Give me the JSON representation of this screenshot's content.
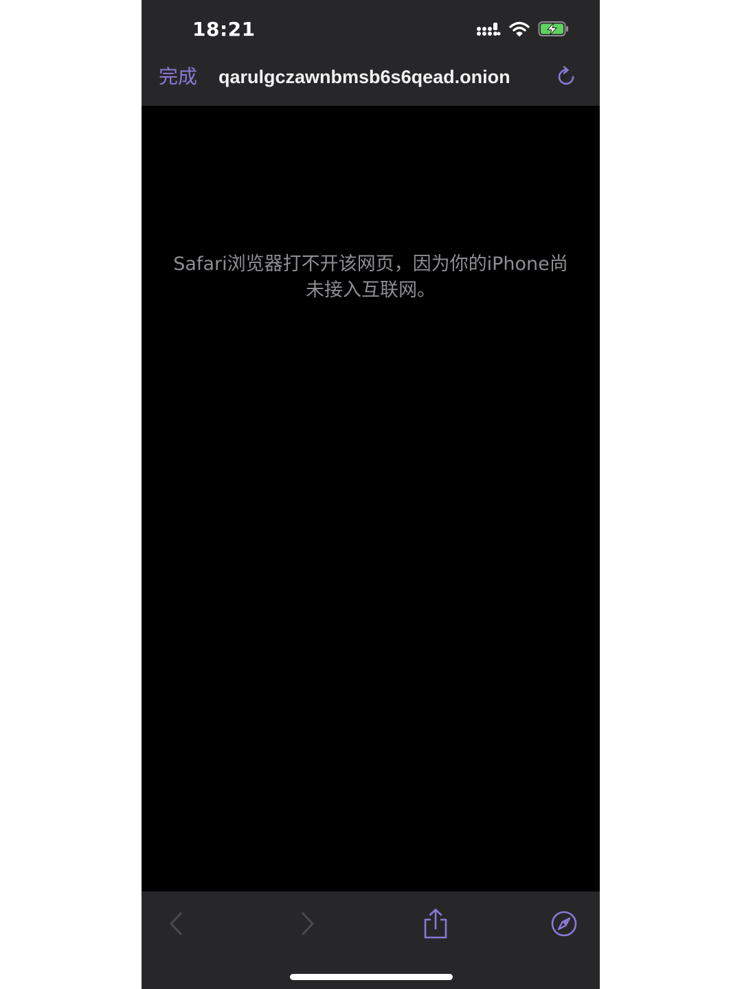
{
  "status_bar": {
    "time": "18:21",
    "icons": [
      "cellular-signal-icon",
      "wifi-icon",
      "battery-charging-icon"
    ]
  },
  "nav_bar": {
    "done_label": "完成",
    "url": "qarulgczawnbmsb6s6qead.onion",
    "reload_icon": "reload-icon"
  },
  "content": {
    "error_message": "Safari浏览器打不开该网页，因为你的iPhone尚未接入互联网。"
  },
  "toolbar": {
    "items": [
      "back-icon",
      "forward-icon",
      "share-icon",
      "compass-icon"
    ]
  },
  "colors": {
    "accent": "#8b78d6",
    "bar_background": "#272729",
    "page_background": "#000000",
    "message_text": "#8e8e93",
    "battery_fill": "#5fd35f"
  }
}
